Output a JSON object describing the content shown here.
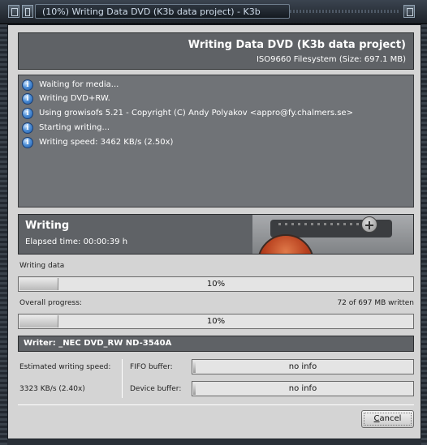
{
  "window": {
    "title": "(10%) Writing Data DVD (K3b data project) - K3b"
  },
  "header": {
    "title": "Writing Data DVD (K3b data project)",
    "subtitle": "ISO9660 Filesystem (Size: 697.1 MB)"
  },
  "log": {
    "items": [
      {
        "icon": "info-icon",
        "text": "Waiting for media..."
      },
      {
        "icon": "info-icon",
        "text": "Writing DVD+RW."
      },
      {
        "icon": "info-icon",
        "text": "Using growisofs 5.21 - Copyright (C) Andy Polyakov <appro@fy.chalmers.se>"
      },
      {
        "icon": "info-icon",
        "text": "Starting writing..."
      },
      {
        "icon": "info-icon",
        "text": "Writing speed: 3462 KB/s (2.50x)"
      }
    ]
  },
  "status": {
    "title": "Writing",
    "elapsed": "Elapsed time: 00:00:39 h"
  },
  "writing_data": {
    "label": "Writing data",
    "percent_text": "10%",
    "fraction": 0.1
  },
  "overall": {
    "label": "Overall progress:",
    "written": "72 of 697 MB written",
    "percent_text": "10%",
    "fraction": 0.1
  },
  "writer": {
    "text": "Writer: _NEC DVD_RW ND-3540A"
  },
  "speed": {
    "label": "Estimated writing speed:",
    "value": "3323 KB/s (2.40x)"
  },
  "fifo": {
    "label": "FIFO buffer:",
    "value": "no info"
  },
  "device": {
    "label": "Device buffer:",
    "value": "no info"
  },
  "cancel": {
    "accel": "C",
    "rest": "ancel"
  }
}
